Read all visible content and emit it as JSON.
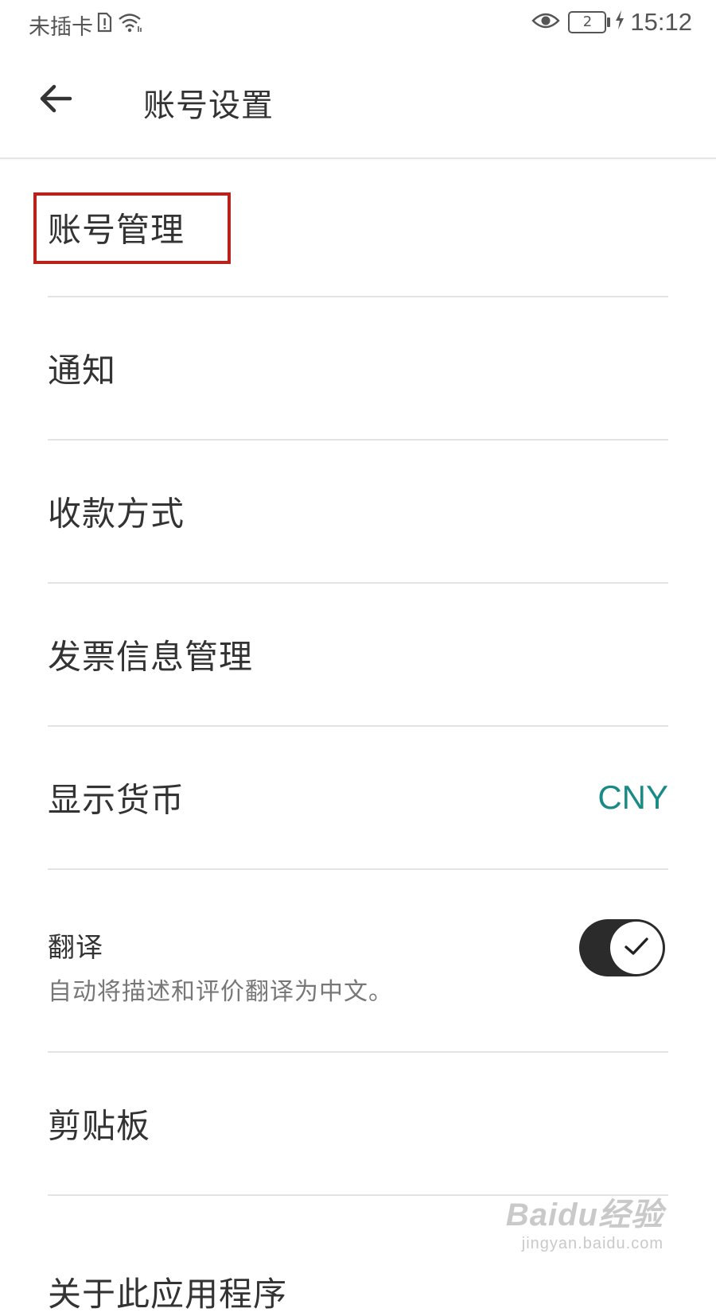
{
  "status_bar": {
    "carrier": "未插卡",
    "battery_level": "2",
    "time": "15:12"
  },
  "app_bar": {
    "title": "账号设置"
  },
  "settings": {
    "account": {
      "label": "账号管理"
    },
    "notifications": {
      "label": "通知"
    },
    "payment": {
      "label": "收款方式"
    },
    "invoice": {
      "label": "发票信息管理"
    },
    "currency": {
      "label": "显示货币",
      "value": "CNY"
    },
    "translate": {
      "label": "翻译",
      "description": "自动将描述和评价翻译为中文。",
      "enabled": true
    },
    "clipboard": {
      "label": "剪贴板"
    },
    "about": {
      "label": "关于此应用程序"
    }
  },
  "colors": {
    "accent": "#1a8a86",
    "highlight": "#b8221b",
    "toggle_on": "#2b2b2b"
  },
  "watermark": {
    "main": "Baidu经验",
    "sub": "jingyan.baidu.com"
  }
}
